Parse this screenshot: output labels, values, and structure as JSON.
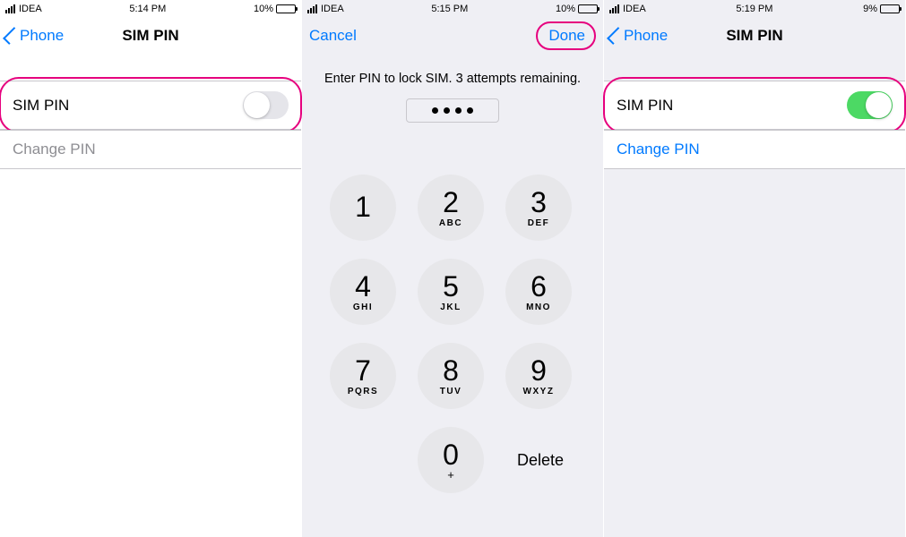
{
  "screens": [
    {
      "status": {
        "carrier": "IDEA",
        "time": "5:14 PM",
        "battery_pct": "10%"
      },
      "nav": {
        "back": "Phone",
        "title": "SIM PIN"
      },
      "row_sim_pin": {
        "label": "SIM PIN",
        "toggle_on": false,
        "highlighted": true
      },
      "row_change_pin": {
        "label": "Change PIN",
        "style": "dim"
      }
    },
    {
      "status": {
        "carrier": "IDEA",
        "time": "5:15 PM",
        "battery_pct": "10%"
      },
      "nav": {
        "cancel": "Cancel",
        "done": "Done",
        "done_highlighted": true
      },
      "prompt": "Enter PIN to lock SIM. 3 attempts remaining.",
      "pin_dots": 4,
      "keypad": [
        {
          "num": "1",
          "letters": ""
        },
        {
          "num": "2",
          "letters": "ABC"
        },
        {
          "num": "3",
          "letters": "DEF"
        },
        {
          "num": "4",
          "letters": "GHI"
        },
        {
          "num": "5",
          "letters": "JKL"
        },
        {
          "num": "6",
          "letters": "MNO"
        },
        {
          "num": "7",
          "letters": "PQRS"
        },
        {
          "num": "8",
          "letters": "TUV"
        },
        {
          "num": "9",
          "letters": "WXYZ"
        },
        {
          "num": "0",
          "letters": "+"
        }
      ],
      "delete": "Delete"
    },
    {
      "status": {
        "carrier": "IDEA",
        "time": "5:19 PM",
        "battery_pct": "9%"
      },
      "nav": {
        "back": "Phone",
        "title": "SIM PIN"
      },
      "row_sim_pin": {
        "label": "SIM PIN",
        "toggle_on": true,
        "highlighted": true
      },
      "row_change_pin": {
        "label": "Change PIN",
        "style": "link"
      }
    }
  ]
}
